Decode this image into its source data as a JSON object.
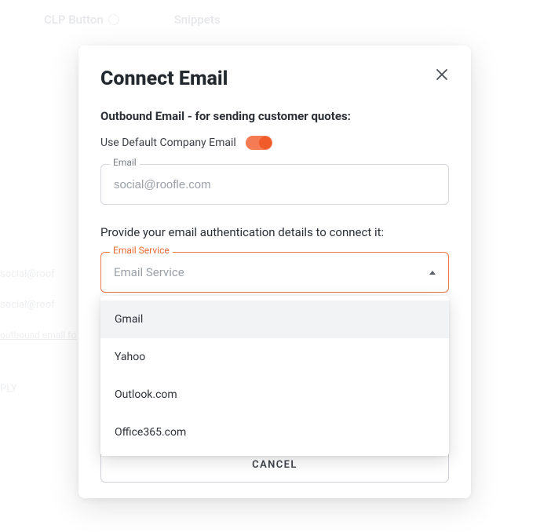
{
  "bg_tabs": {
    "tab0": "CLP Button",
    "tab1": "Snippets"
  },
  "bg_left": {
    "row0": "social@roof",
    "row1": "social@roof",
    "link": "outbound email fo",
    "apply": "PLY"
  },
  "modal": {
    "title": "Connect Email",
    "section_heading": "Outbound Email - for sending customer quotes:",
    "toggle_label": "Use Default Company Email",
    "email_field_label": "Email",
    "email_value": "social@roofle.com",
    "instruction": "Provide your email authentication details to connect it:",
    "service_field_label": "Email Service",
    "service_placeholder": "Email Service",
    "dropdown": {
      "item0": "Gmail",
      "item1": "Yahoo",
      "item2": "Outlook.com",
      "item3": "Office365.com"
    },
    "cancel_label": "CANCEL"
  }
}
